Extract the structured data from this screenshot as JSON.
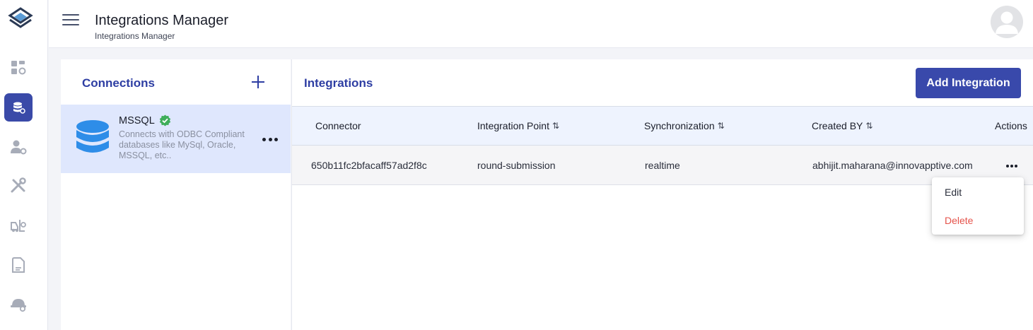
{
  "header": {
    "title": "Integrations Manager",
    "breadcrumb": "Integrations Manager"
  },
  "sidebar": {
    "items": [
      {
        "icon": "dashboard-settings-icon"
      },
      {
        "icon": "database-icon",
        "active": true
      },
      {
        "icon": "user-settings-icon"
      },
      {
        "icon": "tools-icon"
      },
      {
        "icon": "forklift-icon"
      },
      {
        "icon": "document-icon"
      },
      {
        "icon": "hard-hat-icon"
      }
    ]
  },
  "connections": {
    "title": "Connections",
    "items": [
      {
        "name": "MSSQL",
        "description": "Connects with ODBC Compliant databases like MySql, Oracle, MSSQL, etc..",
        "verified": true
      }
    ]
  },
  "integrations": {
    "title": "Integrations",
    "add_label": "Add Integration",
    "columns": [
      "Connector",
      "Integration Point",
      "Synchronization",
      "Created BY",
      "Actions"
    ],
    "sort_glyph": "⇅",
    "rows": [
      {
        "connector": "650b11fc2bfacaff57ad2f8c",
        "integration_point": "round-submission",
        "synchronization": "realtime",
        "created_by": "abhijit.maharana@innovapptive.com"
      }
    ]
  },
  "row_menu": {
    "edit": "Edit",
    "delete": "Delete"
  },
  "colors": {
    "accent": "#3949ab",
    "delete": "#e5534b",
    "verified": "#3fae5a",
    "db_icon": "#2e8de8"
  }
}
